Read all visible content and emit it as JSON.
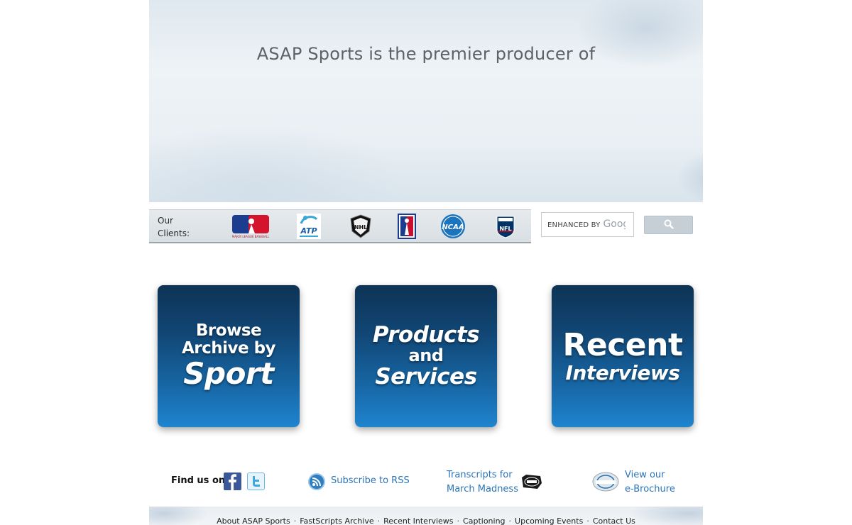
{
  "hero": {
    "headline": "ASAP Sports is the premier producer of"
  },
  "clients": {
    "label": "Our Clients:",
    "logos": [
      {
        "name": "mlb-logo",
        "text": "MAJOR LEAGUE BASEBALL"
      },
      {
        "name": "atp-logo",
        "text": "ATP"
      },
      {
        "name": "nhl-logo",
        "text": "NHL"
      },
      {
        "name": "pga-tour-logo",
        "text": ""
      },
      {
        "name": "ncaa-logo",
        "text": "NCAA"
      },
      {
        "name": "nfl-logo",
        "text": "NFL"
      }
    ]
  },
  "search": {
    "placeholder_enhanced": "ENHANCED BY",
    "placeholder_brand": "Goog",
    "button_icon": "search-icon"
  },
  "tiles": {
    "browse": {
      "line1": "Browse",
      "line2": "Archive by",
      "line3": "Sport"
    },
    "products": {
      "line1": "Products",
      "line2": "and",
      "line3": "Services"
    },
    "recent": {
      "line1": "Recent",
      "line2": "Interviews"
    }
  },
  "footer_links": {
    "find_us": "Find us on",
    "rss": "Subscribe to RSS",
    "march_madness_line1": "Transcripts for",
    "march_madness_line2": "March Madness",
    "brochure_line1": "View our",
    "brochure_line2": "e-Brochure"
  },
  "bottom_nav": [
    "About ASAP Sports",
    "FastScripts Archive",
    "Recent Interviews",
    "Captioning",
    "Upcoming Events",
    "Contact Us"
  ],
  "colors": {
    "tile_top": "#0d3355",
    "tile_bottom": "#1f84cf",
    "link": "#2a75b8"
  }
}
